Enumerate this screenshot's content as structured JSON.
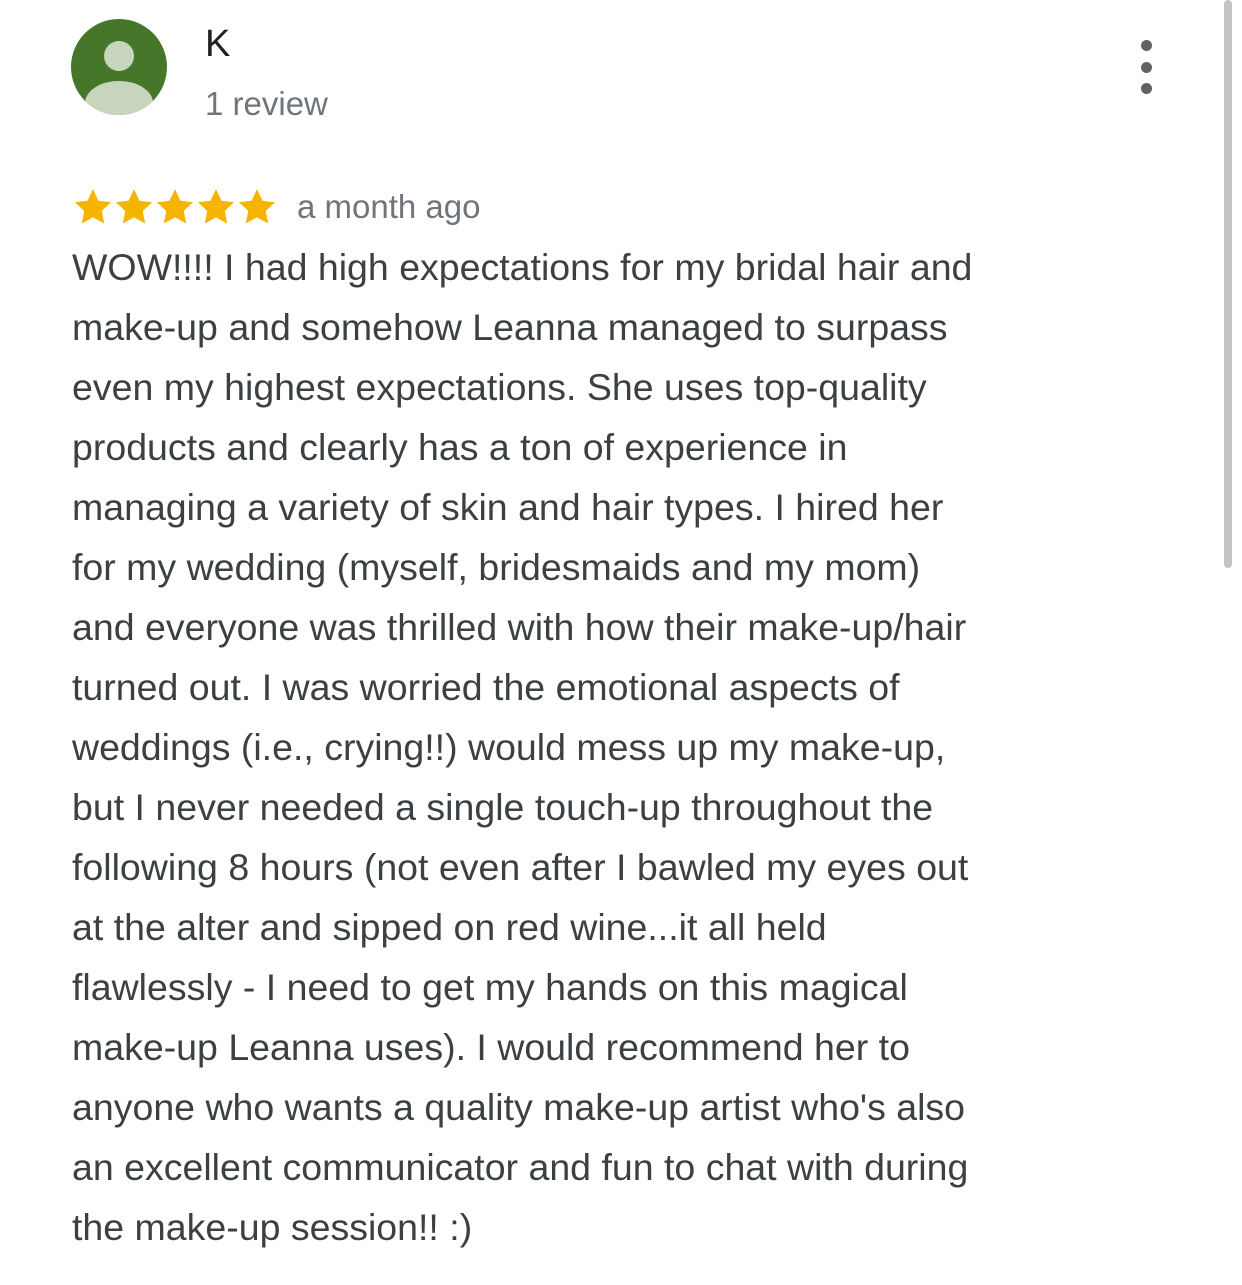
{
  "review": {
    "author_name": "K",
    "author_meta": "1 review",
    "rating": 5,
    "rating_max": 5,
    "date": "a month ago",
    "text_lines": [
      "WOW!!!! I had high expectations for my bridal hair and",
      "make-up and somehow Leanna managed to surpass",
      "even my highest expectations. She uses top-quality",
      "products and clearly has a ton of experience in",
      "managing a variety of skin and hair types. I hired her",
      "for my wedding (myself, bridesmaids and my mom)",
      "and everyone was thrilled with how their make-up/hair",
      "turned out. I was worried the emotional aspects of",
      "weddings (i.e., crying!!) would mess up my make-up,",
      "but I never needed a single touch-up throughout the",
      "following 8 hours (not even after I bawled my eyes out",
      "at the alter and sipped on red wine...it all held",
      "flawlessly - I need to get my hands on this magical",
      "make-up Leanna uses). I would recommend her to",
      "anyone who wants a quality make-up artist who's also",
      "an excellent communicator and fun to chat with during",
      "the make-up session!! :)"
    ]
  },
  "icons": {
    "avatar": "default-person-avatar",
    "menu": "more-vert-icon",
    "star": "star-filled-icon"
  },
  "colors": {
    "avatar_bg": "#467629",
    "avatar_figure": "#c8d5bd",
    "star": "#f4b400",
    "text_primary": "#202124",
    "text_body": "#3c4043",
    "text_secondary": "#70757a"
  }
}
